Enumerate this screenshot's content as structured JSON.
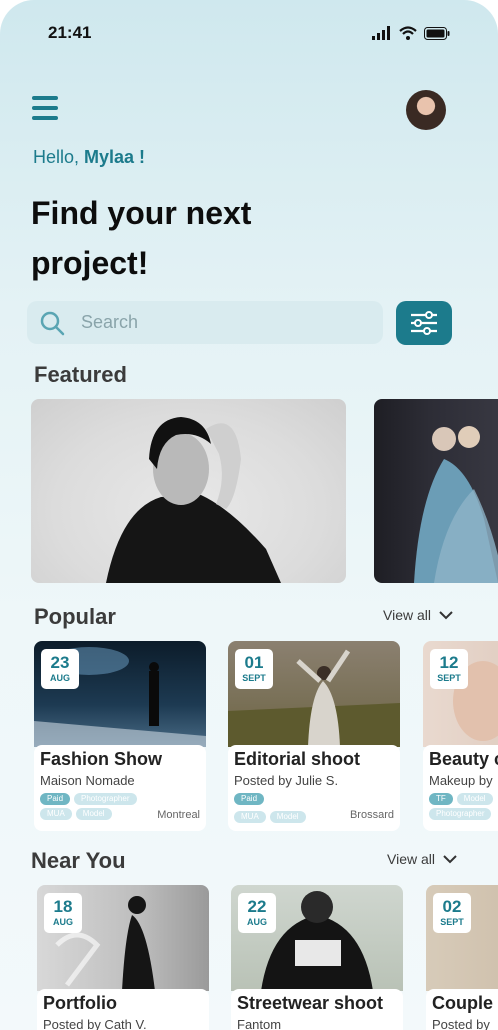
{
  "status": {
    "time": "21:41"
  },
  "greeting": {
    "prefix": "Hello, ",
    "name": "Mylaa !"
  },
  "headline": "Find your next project!",
  "search": {
    "placeholder": "Search"
  },
  "sections": {
    "featured": "Featured",
    "popular": "Popular",
    "near_you": "Near You",
    "view_all": "View all"
  },
  "popular": [
    {
      "day": "23",
      "month": "AUG",
      "title": "Fashion Show",
      "subtitle": "Maison Nomade",
      "tags": [
        "Paid",
        "Photographer",
        "MUA",
        "Model"
      ],
      "city": "Montreal"
    },
    {
      "day": "01",
      "month": "SEPT",
      "title": "Editorial shoot",
      "subtitle": "Posted by Julie S.",
      "tags": [
        "Paid",
        "MUA",
        "Model"
      ],
      "city": "Brossard"
    },
    {
      "day": "12",
      "month": "SEPT",
      "title": "Beauty c",
      "subtitle": "Makeup by",
      "tags": [
        "TF",
        "Model",
        "Photographer"
      ],
      "city": ""
    }
  ],
  "near_you": [
    {
      "day": "18",
      "month": "AUG",
      "title": "Portfolio",
      "subtitle": "Posted by Cath V."
    },
    {
      "day": "22",
      "month": "AUG",
      "title": "Streetwear shoot",
      "subtitle": "Fantom"
    },
    {
      "day": "02",
      "month": "SEPT",
      "title": "Couple",
      "subtitle": "Posted by"
    }
  ],
  "colors": {
    "accent": "#1c7b8c",
    "background_top": "#cfe8ee",
    "search_bg": "#d9ebef"
  },
  "icons": [
    "signal-icon",
    "wifi-icon",
    "battery-icon",
    "menu-icon",
    "search-icon",
    "filter-icon",
    "chevron-down-icon"
  ]
}
